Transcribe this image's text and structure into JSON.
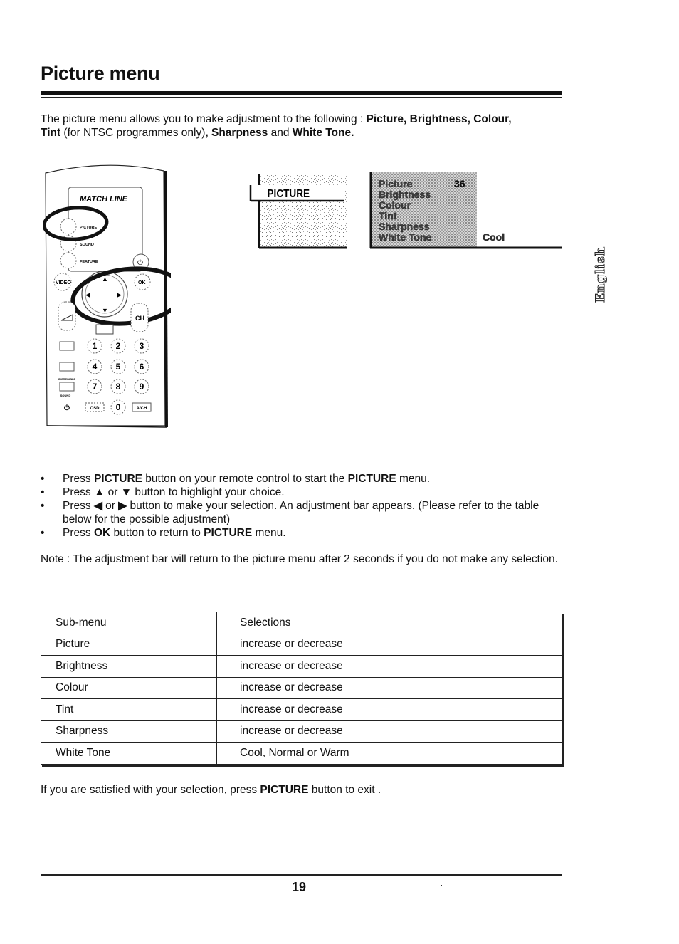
{
  "page": {
    "title": "Picture menu",
    "intro": {
      "t1": "The picture menu allows you to make adjustment to the following : ",
      "b1": "Picture, Brightness, Colour,",
      "b2": "Tint",
      "t2": " (for NTSC programmes only)",
      "b3": ", Sharpness",
      "t3": " and ",
      "b4": "White Tone."
    },
    "side_label": "English",
    "remote": {
      "brand": "MATCH LINE",
      "menu_buttons": [
        "PICTURE",
        "SOUND",
        "FEATURE"
      ],
      "video_label": "VIDEO",
      "ok_label": "OK",
      "ch_label": "CH",
      "power_icon": "power-icon",
      "number_keys": [
        "1",
        "2",
        "3",
        "4",
        "5",
        "6",
        "7",
        "8",
        "9",
        "0"
      ],
      "incredible_label": "INCREDIBLE",
      "sound_label": "SOUND",
      "osd_label": "OSD",
      "ach_label": "A/CH"
    },
    "osd_screen_1": {
      "label": "PICTURE"
    },
    "osd_screen_2": {
      "items": [
        "Picture",
        "Brightness",
        "Colour",
        "Tint",
        "Sharpness",
        "White Tone"
      ],
      "picture_value": "36",
      "white_tone_value": "Cool"
    },
    "steps": [
      {
        "bullet": "•",
        "parts": [
          "Press ",
          "PICTURE",
          " button on your remote control to start the ",
          "PICTURE",
          " menu."
        ]
      },
      {
        "bullet": "•",
        "parts": [
          "Press ",
          "▲",
          " or ",
          "▼",
          " button to highlight your choice."
        ]
      },
      {
        "bullet": "•",
        "parts": [
          "Press ",
          "◀",
          " or ",
          "▶",
          " button to make your selection.  An adjustment bar appears. (Please refer to the table below for the possible adjustment)"
        ]
      },
      {
        "bullet": "•",
        "parts": [
          "Press ",
          "OK",
          " button to return to ",
          "PICTURE",
          " menu."
        ]
      }
    ],
    "note": "Note : The adjustment bar will return to the picture menu after 2 seconds if you do not make any selection.",
    "table": {
      "headers": [
        "Sub-menu",
        "Selections"
      ],
      "rows": [
        [
          "Picture",
          "increase or decrease"
        ],
        [
          "Brightness",
          "increase or decrease"
        ],
        [
          "Colour",
          "increase or decrease"
        ],
        [
          "Tint",
          "increase or decrease"
        ],
        [
          "Sharpness",
          "increase or decrease"
        ],
        [
          "White Tone",
          "Cool, Normal or Warm"
        ]
      ]
    },
    "exit": {
      "t1": "If you are satisfied with your selection, press ",
      "b1": "PICTURE",
      "t2": " button to exit ."
    },
    "page_number": "19"
  }
}
